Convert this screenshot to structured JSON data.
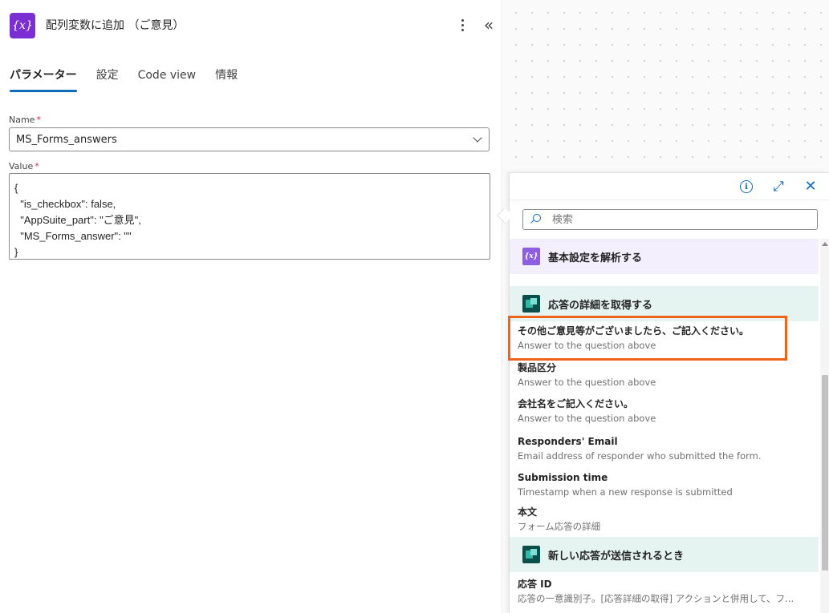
{
  "panel": {
    "icon_label": "{x}",
    "title": "配列変数に追加 （ご意見）"
  },
  "tabs": [
    {
      "label": "パラメーター",
      "active": true
    },
    {
      "label": "設定",
      "active": false
    },
    {
      "label": "Code view",
      "active": false
    },
    {
      "label": "情報",
      "active": false
    }
  ],
  "fields": {
    "name_label": "Name",
    "name_required": "*",
    "name_value": "MS_Forms_answers",
    "value_label": "Value",
    "value_required": "*",
    "value_lines": [
      "{",
      "  \"is_checkbox\": false,",
      "  \"AppSuite_part\": \"ご意見\",",
      "  \"MS_Forms_answer\": \"\"",
      "}"
    ]
  },
  "flyout": {
    "search_placeholder": "検索",
    "groups": [
      {
        "label": "基本設定を解析する",
        "icon": "variable-icon",
        "color": "#f3effc"
      },
      {
        "label": "応答の詳細を取得する",
        "icon": "forms-icon",
        "color": "#e5f3f1"
      },
      {
        "label": "新しい応答が送信されるとき",
        "icon": "forms-icon",
        "color": "#e5f3f1"
      }
    ],
    "items": [
      {
        "title": "その他ご意見等がございましたら、ご記入ください。",
        "desc": "Answer to the question above",
        "highlighted": true
      },
      {
        "title": "製品区分",
        "desc": "Answer to the question above"
      },
      {
        "title": "会社名をご記入ください。",
        "desc": "Answer to the question above"
      },
      {
        "title": "Responders' Email",
        "desc": "Email address of responder who submitted the form."
      },
      {
        "title": "Submission time",
        "desc": "Timestamp when a new response is submitted"
      },
      {
        "title": "本文",
        "desc": "フォーム応答の詳細"
      },
      {
        "title": "応答 ID",
        "desc": "応答の一意識別子。[応答詳細の取得] アクションと併用して、フ..."
      }
    ]
  },
  "colors": {
    "accent": "#0f6cbd",
    "action_icon": "#7b2fd2",
    "highlight": "#f0631c"
  }
}
